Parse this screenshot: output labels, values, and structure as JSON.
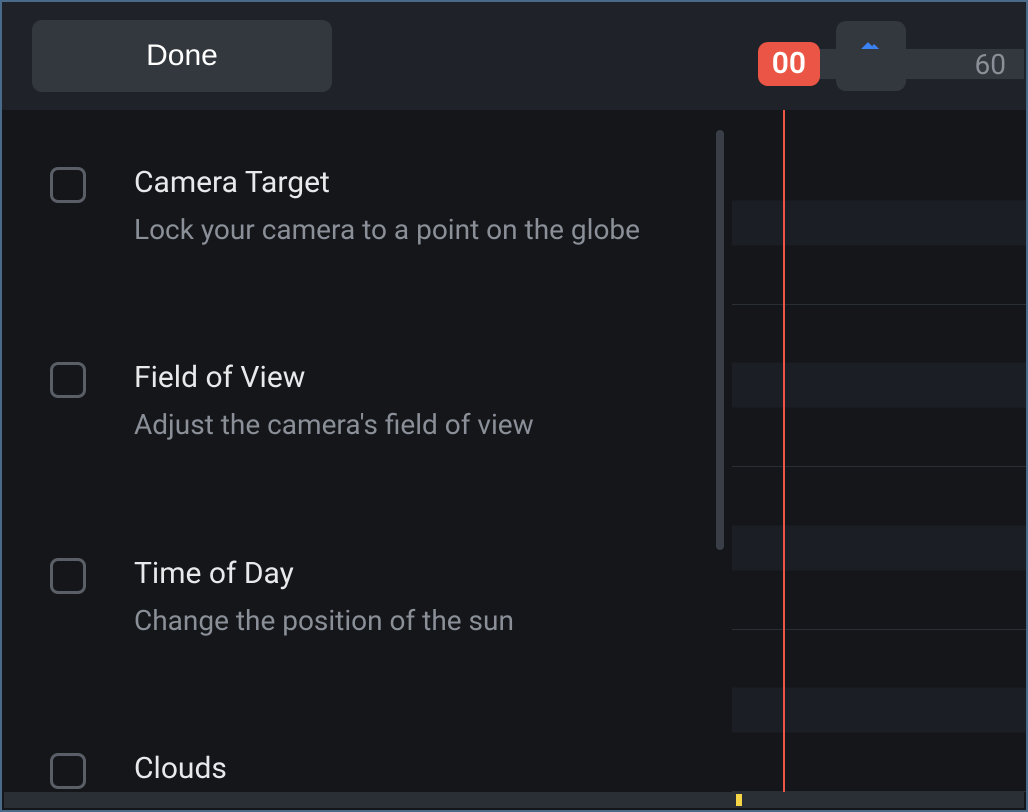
{
  "toolbar": {
    "done_label": "Done"
  },
  "timeline": {
    "playhead": "00",
    "mark_60": "60"
  },
  "effects": [
    {
      "title": "Camera Target",
      "description": "Lock your camera to a point on the globe"
    },
    {
      "title": "Field of View",
      "description": "Adjust the camera's field of view"
    },
    {
      "title": "Time of Day",
      "description": "Change the position of the sun"
    },
    {
      "title": "Clouds",
      "description": ""
    }
  ],
  "colors": {
    "accent_blue": "#3b82f6",
    "playhead_red": "#eb5545",
    "background": "#14161a",
    "panel": "#1f2329",
    "button": "#33373e",
    "thumb_yellow": "#f5d547"
  }
}
